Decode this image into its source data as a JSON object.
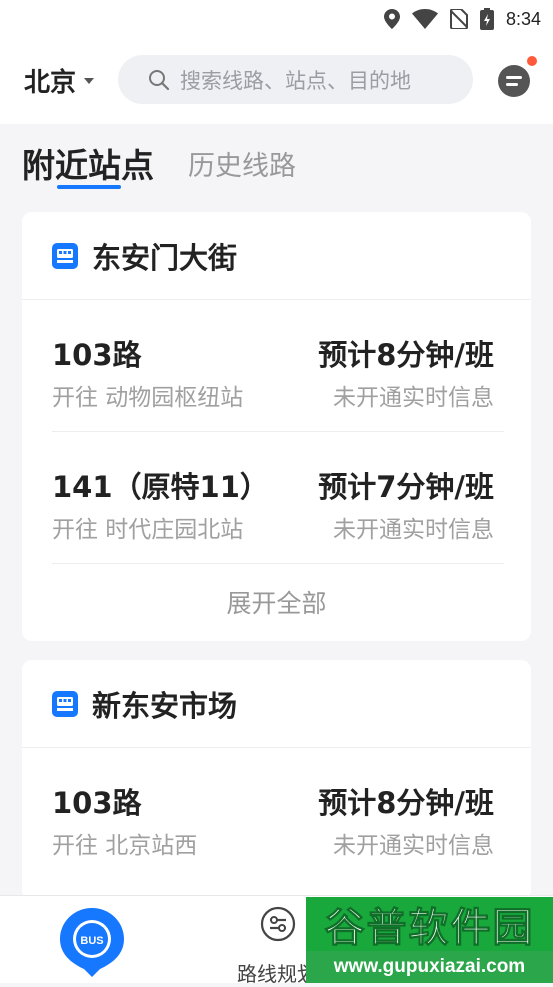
{
  "status_bar": {
    "time": "8:34"
  },
  "header": {
    "city": "北京",
    "search_placeholder": "搜索线路、站点、目的地"
  },
  "tabs": [
    {
      "label": "附近站点",
      "active": true
    },
    {
      "label": "历史线路",
      "active": false
    }
  ],
  "stations": [
    {
      "name": "东安门大街",
      "routes": [
        {
          "name": "103路",
          "direction": "开往 动物园枢纽站",
          "eta": "预计8分钟/班",
          "realtime": "未开通实时信息"
        },
        {
          "name": "141（原特11）",
          "direction": "开往 时代庄园北站",
          "eta": "预计7分钟/班",
          "realtime": "未开通实时信息"
        }
      ],
      "expand_label": "展开全部"
    },
    {
      "name": "新东安市场",
      "routes": [
        {
          "name": "103路",
          "direction": "开往 北京站西",
          "eta": "预计8分钟/班",
          "realtime": "未开通实时信息"
        }
      ]
    }
  ],
  "bottom_nav": {
    "bus_badge": "BUS",
    "route_planning_label": "路线规划"
  },
  "watermark": {
    "title": "谷普软件园",
    "url": "www.gupuxiazai.com"
  },
  "colors": {
    "accent": "#1677ff",
    "notification": "#ff5a3a",
    "watermark_green": "#19a83c"
  },
  "icons": [
    "location-icon",
    "wifi-icon",
    "no-sim-icon",
    "battery-icon",
    "search-icon",
    "message-icon",
    "bus-stop-icon",
    "bus-pin-icon",
    "route-planning-icon"
  ]
}
